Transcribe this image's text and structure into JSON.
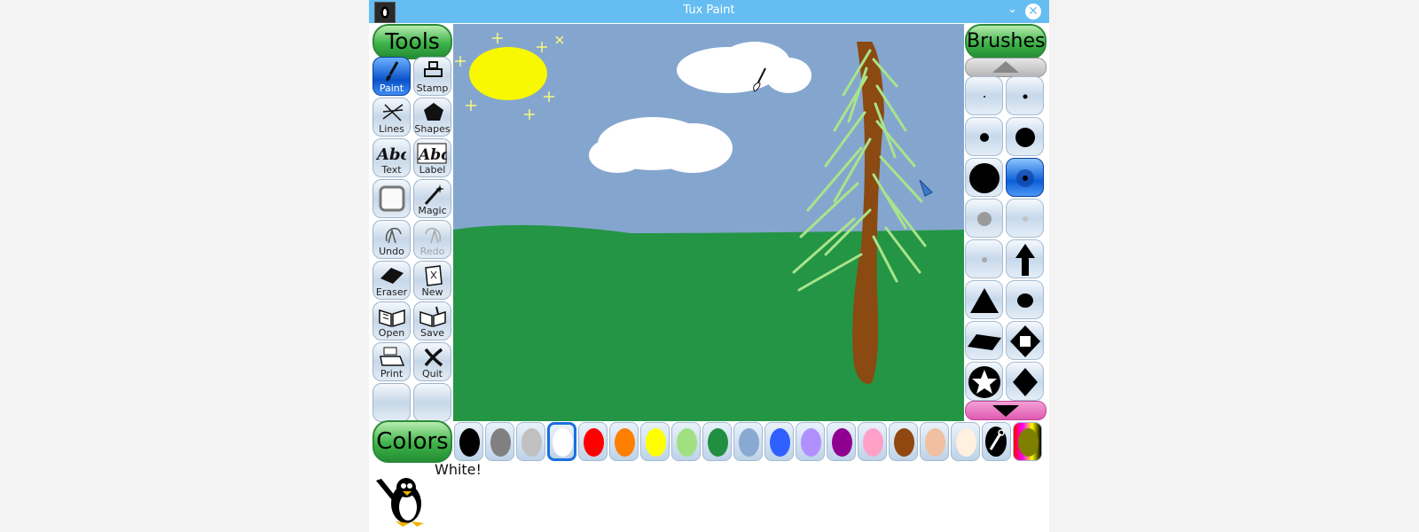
{
  "window": {
    "title": "Tux Paint"
  },
  "headers": {
    "tools": "Tools",
    "brushes": "Brushes",
    "colors": "Colors"
  },
  "tools": [
    {
      "label": "Paint",
      "icon": "paintbrush-icon",
      "active": true
    },
    {
      "label": "Stamp",
      "icon": "stamp-icon"
    },
    {
      "label": "Lines",
      "icon": "lines-icon"
    },
    {
      "label": "Shapes",
      "icon": "pentagon-icon"
    },
    {
      "label": "Text",
      "icon": "text-abc-icon"
    },
    {
      "label": "Label",
      "icon": "label-abc-icon"
    },
    {
      "label": "",
      "icon": "fill-square-icon"
    },
    {
      "label": "Magic",
      "icon": "magic-wand-icon"
    },
    {
      "label": "Undo",
      "icon": "undo-icon"
    },
    {
      "label": "Redo",
      "icon": "redo-icon",
      "disabled": true
    },
    {
      "label": "Eraser",
      "icon": "eraser-icon"
    },
    {
      "label": "New",
      "icon": "new-page-icon"
    },
    {
      "label": "Open",
      "icon": "open-book-icon"
    },
    {
      "label": "Save",
      "icon": "save-book-icon"
    },
    {
      "label": "Print",
      "icon": "printer-icon"
    },
    {
      "label": "Quit",
      "icon": "quit-x-icon"
    }
  ],
  "brushes": [
    "tiny-dot",
    "small-dot",
    "medium-dot",
    "large-dot",
    "huge-dot",
    "fuzzy-dot",
    "gray-dot",
    "faint-dot",
    "faint-dot-2",
    "arrow-up",
    "triangle",
    "round-blob",
    "parallelogram",
    "diamond-square",
    "star",
    "diamond"
  ],
  "selected_brush": "fuzzy-dot",
  "colors": [
    {
      "name": "black",
      "hex": "#000000"
    },
    {
      "name": "dark-gray",
      "hex": "#808080"
    },
    {
      "name": "light-gray",
      "hex": "#c0c0c0"
    },
    {
      "name": "white",
      "hex": "#ffffff",
      "selected": true
    },
    {
      "name": "red",
      "hex": "#ff0000"
    },
    {
      "name": "orange",
      "hex": "#ff8000"
    },
    {
      "name": "yellow",
      "hex": "#ffff00"
    },
    {
      "name": "light-green",
      "hex": "#a0e080"
    },
    {
      "name": "green",
      "hex": "#209040"
    },
    {
      "name": "sky-blue",
      "hex": "#88aad0"
    },
    {
      "name": "blue",
      "hex": "#3060ff"
    },
    {
      "name": "lavender",
      "hex": "#b090ff"
    },
    {
      "name": "purple",
      "hex": "#900090"
    },
    {
      "name": "pink",
      "hex": "#ffa0c8"
    },
    {
      "name": "brown",
      "hex": "#904810"
    },
    {
      "name": "tan",
      "hex": "#f0c0a0"
    },
    {
      "name": "beige",
      "hex": "#fff0e0"
    }
  ],
  "status": {
    "message": "White!"
  }
}
